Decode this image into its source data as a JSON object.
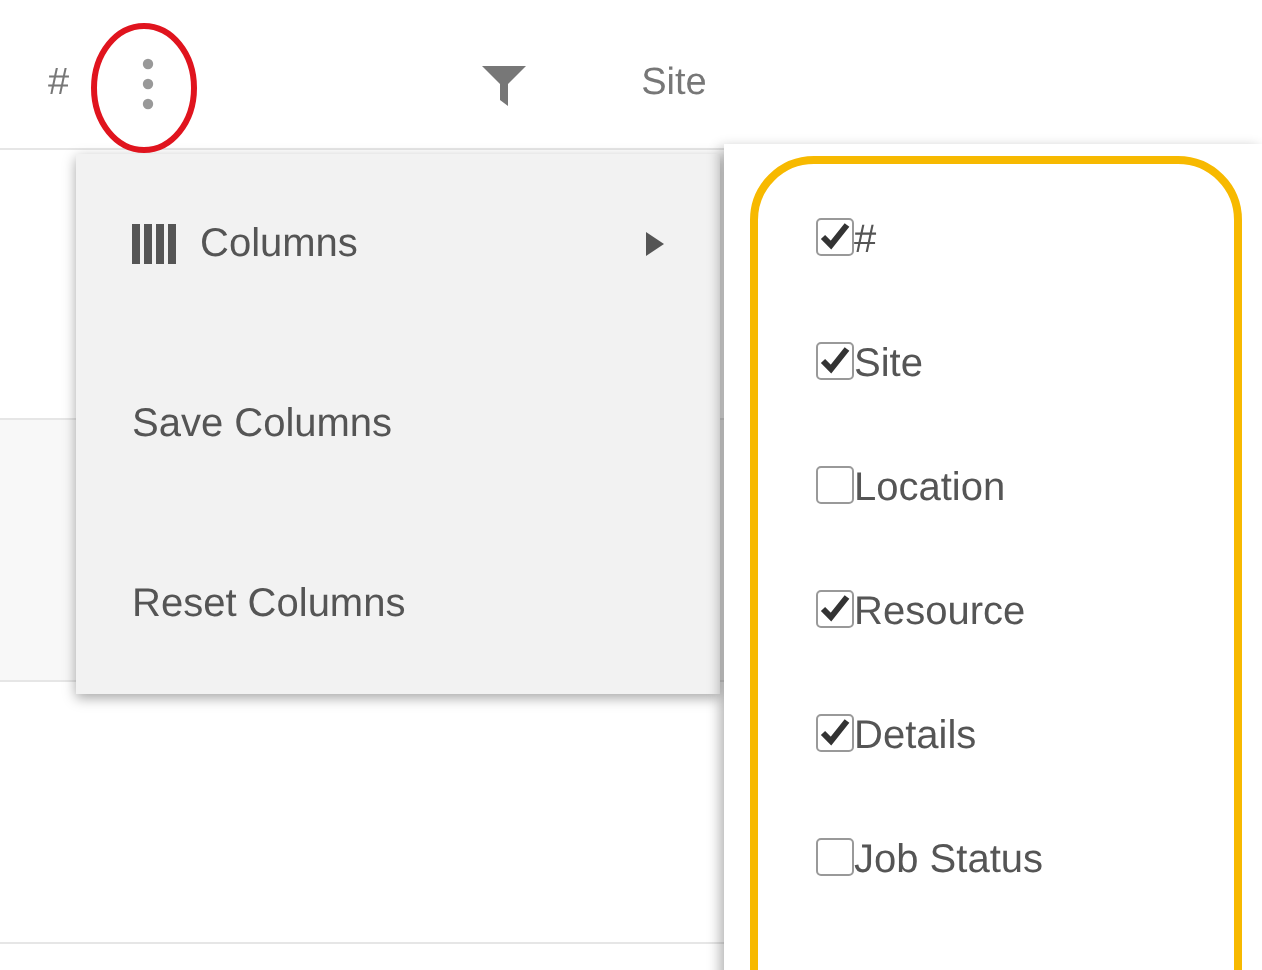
{
  "header": {
    "number_column": "#",
    "site_column": "Site"
  },
  "menu": {
    "items": [
      {
        "kind": "submenu",
        "label": "Columns"
      },
      {
        "kind": "action",
        "label": "Save Columns"
      },
      {
        "kind": "action",
        "label": "Reset Columns"
      }
    ]
  },
  "column_picker": {
    "options": [
      {
        "label": "#",
        "checked": true
      },
      {
        "label": "Site",
        "checked": true
      },
      {
        "label": "Location",
        "checked": false
      },
      {
        "label": "Resource",
        "checked": true
      },
      {
        "label": "Details",
        "checked": true
      },
      {
        "label": "Job Status",
        "checked": false
      }
    ]
  }
}
